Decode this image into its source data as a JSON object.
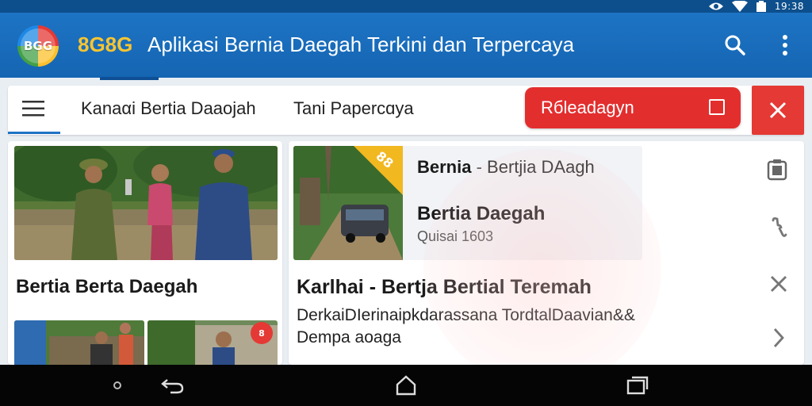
{
  "status_bar": {
    "time": "19:38",
    "icons": [
      "eye-icon",
      "wifi-icon",
      "battery-icon"
    ]
  },
  "app_bar": {
    "logo_text": "BGG",
    "brand": "8G8G",
    "title": "Aplikasi Bernia Daegah Terkini dan Terpercaya",
    "actions": [
      "search-icon",
      "more-vert-icon"
    ]
  },
  "nav": {
    "tabs": [
      "Kanaαi Bertia Daaojah",
      "Tani Papercɑya"
    ],
    "action_label": "Rбleadagyn"
  },
  "left_card": {
    "headline": "Bertia Berta Daegah",
    "thumb_badge": "8"
  },
  "feature": {
    "badge": "88",
    "line1_bold": "Bernia",
    "line1_sep": " - ",
    "line1_rest": "Bertjia DAagh",
    "title": "Bertia Daegah",
    "meta": "Quisai 1603"
  },
  "right_card": {
    "headline": "Karlhai - Bertja Bertial Teremah",
    "summary": "DerkaiDIerinaipkdarassana TordtalDaavian&& Dempa aoaga"
  },
  "colors": {
    "status_bar": "#0d4f8c",
    "app_bar": "#1d74c4",
    "brand_yellow": "#f7c531",
    "action_red": "#e32e2e",
    "badge_yellow": "#f2b820",
    "system_nav": "#050505"
  }
}
